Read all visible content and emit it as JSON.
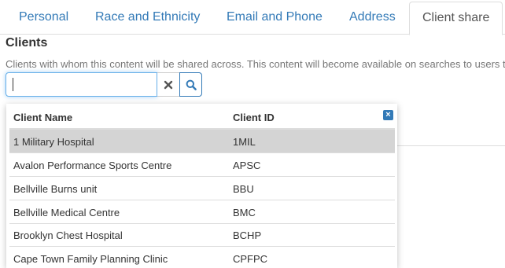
{
  "tabs": [
    {
      "label": "Personal"
    },
    {
      "label": "Race and Ethnicity"
    },
    {
      "label": "Email and Phone"
    },
    {
      "label": "Address"
    },
    {
      "label": "Client share"
    }
  ],
  "active_tab": "Client share",
  "section": {
    "title": "Clients",
    "helper": "Clients with whom this content will be shared across. This content will become available on searches to users that"
  },
  "search": {
    "value": "",
    "clear_icon": "times-icon",
    "search_icon": "magnifier-icon"
  },
  "dropdown": {
    "columns": [
      "Client Name",
      "Client ID"
    ],
    "close_icon": "close-icon",
    "rows": [
      {
        "name": "1 Military Hospital",
        "id": "1MIL",
        "selected": true
      },
      {
        "name": "Avalon Performance Sports Centre",
        "id": "APSC"
      },
      {
        "name": "Bellville Burns unit",
        "id": "BBU"
      },
      {
        "name": "Bellville Medical Centre",
        "id": "BMC"
      },
      {
        "name": "Brooklyn Chest Hospital",
        "id": "BCHP"
      },
      {
        "name": "Cape Town Family Planning Clinic",
        "id": "CPFPC"
      }
    ]
  },
  "colors": {
    "link": "#337ab7",
    "selected_row": "#d4d4d4",
    "focus_border": "#66afe9"
  }
}
